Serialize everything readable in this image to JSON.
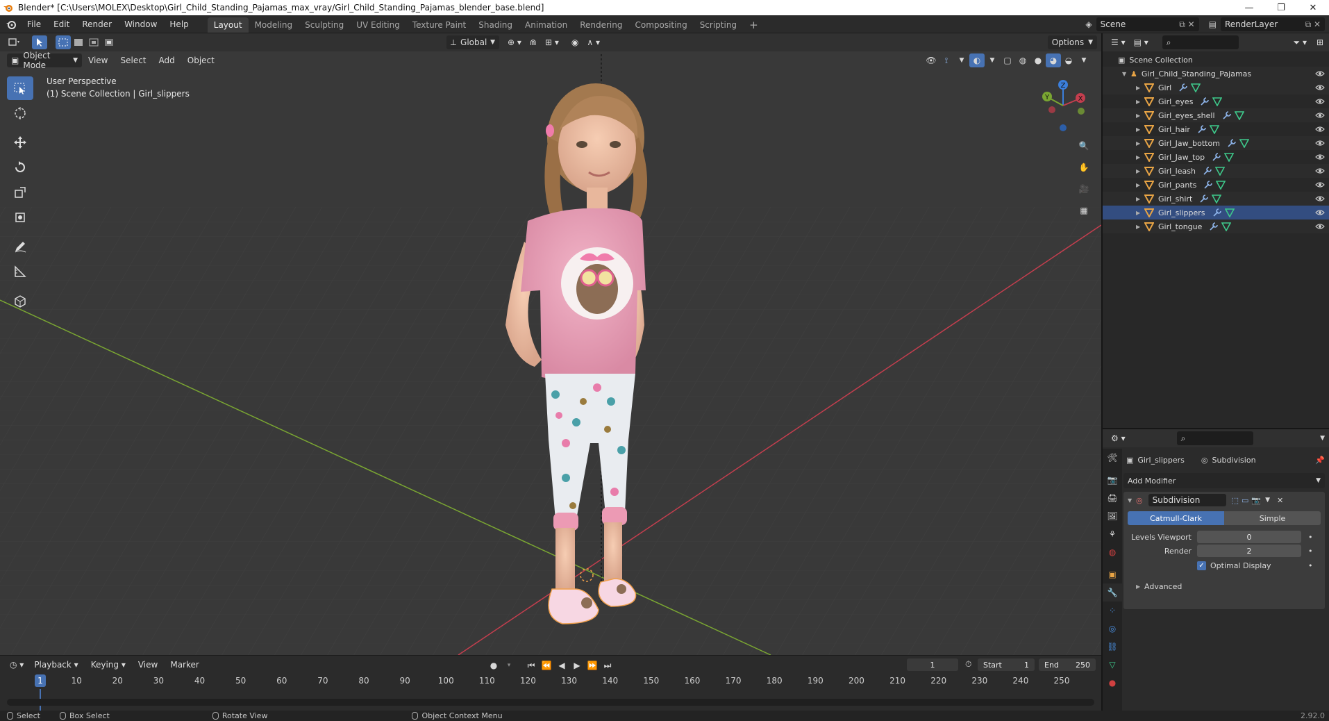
{
  "window": {
    "title": "Blender* [C:\\Users\\MOLEX\\Desktop\\Girl_Child_Standing_Pajamas_max_vray/Girl_Child_Standing_Pajamas_blender_base.blend]",
    "minimize": "—",
    "restore": "❐",
    "close": "✕"
  },
  "menu": [
    "File",
    "Edit",
    "Render",
    "Window",
    "Help"
  ],
  "workspaces": [
    "Layout",
    "Modeling",
    "Sculpting",
    "UV Editing",
    "Texture Paint",
    "Shading",
    "Animation",
    "Rendering",
    "Compositing",
    "Scripting"
  ],
  "workspace_add": "+",
  "scene_field": "Scene",
  "renderlayer_field": "RenderLayer",
  "viewport": {
    "transform_orientation": "Global",
    "options_label": "Options",
    "mode": "Object Mode",
    "menus": [
      "View",
      "Select",
      "Add",
      "Object"
    ],
    "overlay_line1": "User Perspective",
    "overlay_line2": "(1) Scene Collection | Girl_slippers",
    "gizmo": {
      "x": "X",
      "y": "Y",
      "z": "Z"
    }
  },
  "outliner": {
    "root": "Scene Collection",
    "collection": "Girl_Child_Standing_Pajamas",
    "objects": [
      "Girl",
      "Girl_eyes",
      "Girl_eyes_shell",
      "Girl_hair",
      "Girl_Jaw_bottom",
      "Girl_Jaw_top",
      "Girl_leash",
      "Girl_pants",
      "Girl_shirt",
      "Girl_slippers",
      "Girl_tongue"
    ],
    "selected": "Girl_slippers"
  },
  "properties": {
    "object_name": "Girl_slippers",
    "modifier_breadcrumb": "Subdivision",
    "add_modifier": "Add Modifier",
    "modifier_name": "Subdivision",
    "catmull": "Catmull-Clark",
    "simple": "Simple",
    "levels_viewport_label": "Levels Viewport",
    "levels_viewport_value": "0",
    "render_label": "Render",
    "render_value": "2",
    "optimal_display": "Optimal Display",
    "advanced": "Advanced"
  },
  "timeline": {
    "menus": [
      "Playback",
      "Keying",
      "View",
      "Marker"
    ],
    "current_frame": "1",
    "start_label": "Start",
    "start_value": "1",
    "end_label": "End",
    "end_value": "250",
    "ticks": [
      "10",
      "20",
      "30",
      "40",
      "50",
      "60",
      "70",
      "80",
      "90",
      "100",
      "110",
      "120",
      "130",
      "140",
      "150",
      "160",
      "170",
      "180",
      "190",
      "200",
      "210",
      "220",
      "230",
      "240",
      "250"
    ],
    "cursor": "1"
  },
  "status": {
    "select": "Select",
    "box_select": "Box Select",
    "rotate_view": "Rotate View",
    "context_menu": "Object Context Menu",
    "version": "2.92.0"
  },
  "colors": {
    "accent": "#4772b3",
    "axis_x": "#c43e4e",
    "axis_y": "#7aa632",
    "axis_z": "#3b7fdd"
  }
}
